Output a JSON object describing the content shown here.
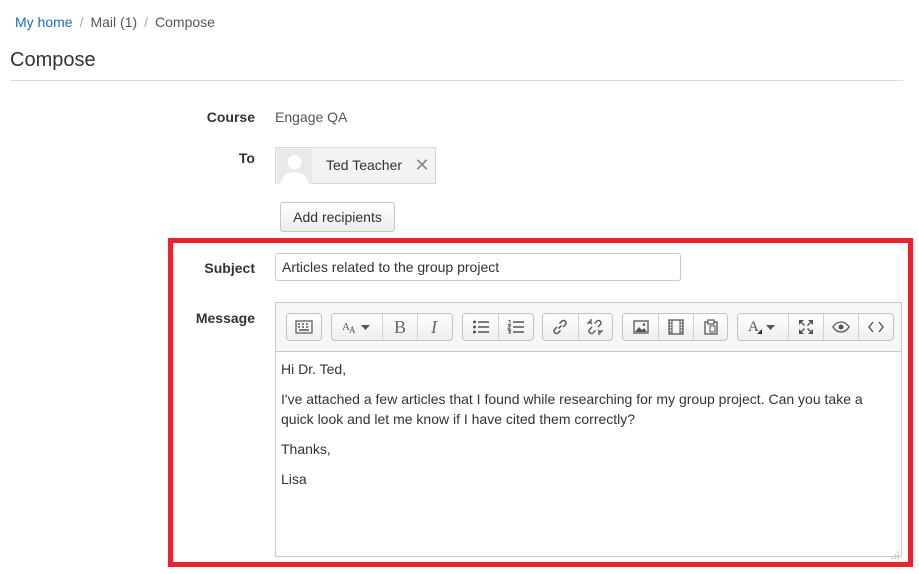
{
  "breadcrumb": [
    {
      "label": "My home",
      "link": true
    },
    {
      "label": "Mail (1)",
      "link": false
    },
    {
      "label": "Compose",
      "link": false
    }
  ],
  "page_title": "Compose",
  "form": {
    "course_label": "Course",
    "course_value": "Engage QA",
    "to_label": "To",
    "recipient": {
      "name": "Ted Teacher",
      "remove_icon": "close-icon"
    },
    "add_recipients_label": "Add recipients",
    "subject_label": "Subject",
    "subject_value": "Articles related to the group project",
    "message_label": "Message"
  },
  "toolbar_groups": [
    [
      "show-more-icon"
    ],
    [
      "font-size-icon",
      "bold-icon",
      "italic-icon"
    ],
    [
      "unordered-list-icon",
      "ordered-list-icon"
    ],
    [
      "link-icon",
      "unlink-icon"
    ],
    [
      "image-icon",
      "media-icon",
      "paste-icon"
    ],
    [
      "font-color-icon",
      "fullscreen-icon",
      "preview-icon",
      "html-icon"
    ]
  ],
  "message_body": {
    "greeting": "Hi Dr. Ted,",
    "paragraph": "I've attached a few articles that I found while researching for my group project.  Can you take a quick look and let me know if I have cited them correctly?",
    "closing": "Thanks,",
    "signature": "Lisa"
  },
  "colors": {
    "highlight_border": "#e8232f",
    "link": "#1a6fb5"
  }
}
